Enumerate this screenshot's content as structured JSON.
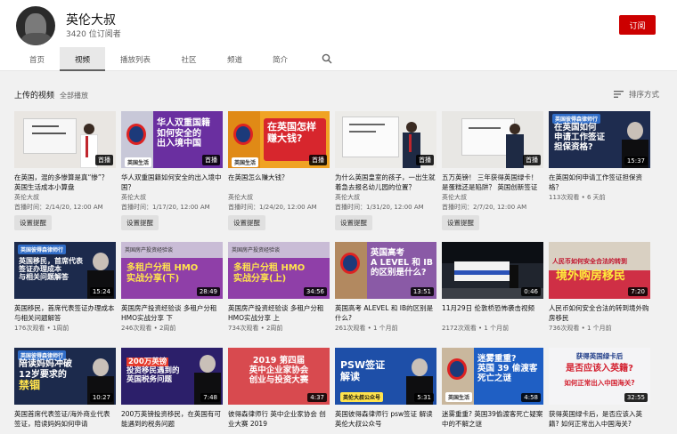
{
  "channel": {
    "name": "英伦大叔",
    "subscribers": "3420 位订阅者",
    "subscribe_label": "订阅"
  },
  "tabs": [
    "首页",
    "视频",
    "播放列表",
    "社区",
    "频道",
    "简介"
  ],
  "section": {
    "title": "上传的视频",
    "play_all": "全部播放",
    "sort_label": "排序方式"
  },
  "colors": {
    "accent": "#cc0000",
    "reminder_bg": "#e0e0e0"
  },
  "videos": [
    {
      "title": "在英国，混的多惨算是真“惨”？ 英国生活成本小算盘",
      "channel": "英伦大叔",
      "meta": "首播时间：2/14/20, 12:00 AM",
      "duration": "首播",
      "reminder": "设置提醒",
      "thumb_text": ""
    },
    {
      "title": "华人双重国籍如何安全的出入境中国？",
      "channel": "英伦大叔",
      "meta": "首播时间：1/17/20, 12:00 AM",
      "duration": "首播",
      "reminder": "设置提醒",
      "thumb_text": "华人双重国籍|如何安全的|出入境中国"
    },
    {
      "title": "在英国怎么赚大钱？",
      "channel": "英伦大叔",
      "meta": "首播时间：1/24/20, 12:00 AM",
      "duration": "首播",
      "reminder": "设置提醒",
      "thumb_text": "在英国怎样|赚大钱?"
    },
    {
      "title": "为什么英国皇室的孩子，一出生就着急去报名幼儿园的位置？",
      "channel": "英伦大叔",
      "meta": "首播时间：1/31/20, 12:00 AM",
      "duration": "首播",
      "reminder": "设置提醒",
      "thumb_text": ""
    },
    {
      "title": "五万英镑！ 三年获得英国绿卡！ 是蛋糕还是陷阱？ 英国创新签证全面解析",
      "channel": "英伦大叔",
      "meta": "首播时间：2/7/20, 12:00 AM",
      "duration": "首播",
      "reminder": "设置提醒",
      "thumb_text": ""
    },
    {
      "title": "在英国如何申请工作签证担保资格？",
      "channel": "",
      "meta": "113次观看 • 6 天前",
      "duration": "15:37",
      "reminder": "",
      "thumb_text": "在英国如何|申请工作签证|担保资格?"
    },
    {
      "title": "英国移民，首席代表签证办理成本与相关问题解答",
      "channel": "",
      "meta": "176次观看 • 1周前",
      "duration": "15:24",
      "reminder": "",
      "thumb_text": "英国移民，首席代表|签证办理成本|与相关问题解答"
    },
    {
      "title": "英国房产投资经验谈 多租户分租HMO实战分享 下",
      "channel": "",
      "meta": "246次观看 • 2周前",
      "duration": "28:49",
      "reminder": "",
      "thumb_text": "多租户分租 HMO|实战分享(下)"
    },
    {
      "title": "英国房产投资经验谈 多租户分租HMO实战分享 上",
      "channel": "",
      "meta": "734次观看 • 2周前",
      "duration": "34:56",
      "reminder": "",
      "thumb_text": "多租户分租 HMO|实战分享(上)"
    },
    {
      "title": "英国高考 ALEVEL 和 IB的区别是什么?",
      "channel": "",
      "meta": "261次观看 • 1 个月前",
      "duration": "13:51",
      "reminder": "",
      "thumb_text": "英国高考|A LEVEL 和 IB|的区别是什么?"
    },
    {
      "title": "11月29日 伦敦桥恐怖袭击视频",
      "channel": "",
      "meta": "2172次观看 • 1 个月前",
      "duration": "0:46",
      "reminder": "",
      "thumb_text": ""
    },
    {
      "title": "人民币如何安全合法的转到境外购房移民",
      "channel": "",
      "meta": "736次观看 • 1 个月前",
      "duration": "7:20",
      "reminder": "",
      "thumb_text": "人民币如何安全合法的转到|境外购房移民"
    },
    {
      "title": "英国首席代表签证/海外商业代表签证，陪读妈妈如何申请",
      "channel": "",
      "meta": "",
      "duration": "10:27",
      "reminder": "",
      "thumb_text": "陪读妈妈冲破|12岁要求的|禁锢"
    },
    {
      "title": "200万英镑投资移民，在英国有可能遇到的税务问题",
      "channel": "",
      "meta": "",
      "duration": "7:48",
      "reminder": "",
      "thumb_text": "200万英镑|投资移民遇到的|英国税务问题"
    },
    {
      "title": "彼得森律师行 英中企业家协会 创业大赛 2019",
      "channel": "",
      "meta": "",
      "duration": "4:37",
      "reminder": "",
      "thumb_text": "2019 第四届|英中企业家协会|创业与投资大赛"
    },
    {
      "title": "英国彼得森律师行 psw签证 解读 英伦大叔公众号",
      "channel": "",
      "meta": "",
      "duration": "5:31",
      "reminder": "",
      "thumb_text": "PSW签证|解读"
    },
    {
      "title": "迷雾重重? 英国39偷渡客死亡疑案中的不解之谜",
      "channel": "",
      "meta": "",
      "duration": "4:58",
      "reminder": "",
      "thumb_text": "迷雾重重?|英国 39 偷渡客|死亡之谜"
    },
    {
      "title": "获得英国绿卡后，是否应该入英籍? 如何正常出入中国海关?",
      "channel": "",
      "meta": "",
      "duration": "32:55",
      "reminder": "",
      "thumb_text": "获得英国绿卡后|是否应该入英籍?|如何正常出入中国海关?"
    }
  ]
}
